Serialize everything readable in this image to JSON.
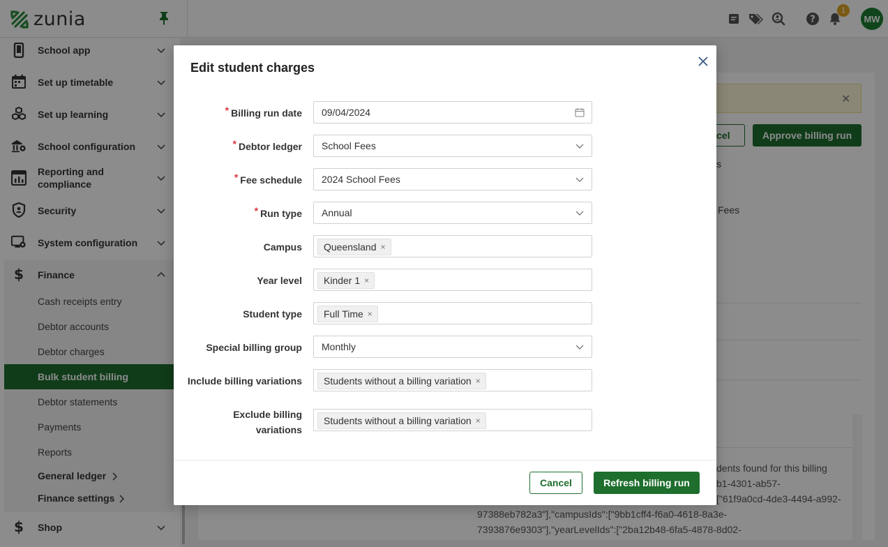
{
  "header": {
    "logo_text": "zunia",
    "notification_count": "1",
    "avatar_initials": "MW"
  },
  "sidebar": {
    "items": [
      {
        "label": "School app",
        "icon": "phone-icon"
      },
      {
        "label": "Set up timetable",
        "icon": "calendar-icon"
      },
      {
        "label": "Set up learning",
        "icon": "cubes-icon"
      },
      {
        "label": "School configuration",
        "icon": "school-gear-icon"
      },
      {
        "label": "Reporting and compliance",
        "icon": "report-icon"
      },
      {
        "label": "Security",
        "icon": "shield-icon"
      },
      {
        "label": "System configuration",
        "icon": "system-gear-icon"
      },
      {
        "label": "Finance",
        "icon": "dollar-icon"
      },
      {
        "label": "Shop",
        "icon": "dollar-icon"
      }
    ],
    "finance_sub": [
      "Cash receipts entry",
      "Debtor accounts",
      "Debtor charges",
      "Bulk student billing",
      "Debtor statements",
      "Payments",
      "Reports"
    ],
    "finance_groups": [
      "General ledger",
      "Finance settings"
    ]
  },
  "background": {
    "cancel_partial": "cel",
    "approve_label": "Approve billing run",
    "text_s": "s",
    "text_fees": "Fees",
    "log_line1": "dents found for this billing",
    "log_line2": "b1-4301-ab57-",
    "log_line3": "97388eb782a3\"],\"campusIds\":[\"9bb1cff4-f6a0-4618-8a3e-",
    "log_line4": "7393876e9303\"],\"yearLevelIds\":[\"2ba12b48-6fa5-4878-8d02-",
    "log_line5": "[\"61f9a0cd-4de3-4494-a992-"
  },
  "modal": {
    "title": "Edit student charges",
    "fields": {
      "billing_run_date": {
        "label": "Billing run date",
        "value": "09/04/2024"
      },
      "debtor_ledger": {
        "label": "Debtor ledger",
        "value": "School Fees"
      },
      "fee_schedule": {
        "label": "Fee schedule",
        "value": "2024 School Fees"
      },
      "run_type": {
        "label": "Run type",
        "value": "Annual"
      },
      "campus": {
        "label": "Campus",
        "tag": "Queensland"
      },
      "year_level": {
        "label": "Year level",
        "tag": "Kinder 1"
      },
      "student_type": {
        "label": "Student type",
        "tag": "Full Time"
      },
      "special_billing_group": {
        "label": "Special billing group",
        "value": "Monthly"
      },
      "include_variations": {
        "label": "Include billing variations",
        "tag": "Students without a billing variation"
      },
      "exclude_variations": {
        "label_line1": "Exclude billing",
        "label_line2": "variations",
        "tag": "Students without a billing variation"
      }
    },
    "required_marker": "*",
    "tag_remove": "×",
    "cancel_label": "Cancel",
    "refresh_label": "Refresh billing run"
  },
  "colors": {
    "brand_green": "#1e6e2e",
    "required_red": "#d9363e",
    "badge_amber": "#e0a526"
  }
}
